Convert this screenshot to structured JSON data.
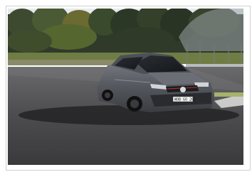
{
  "image": {
    "subject": "car-photo",
    "license_plate": "WOB GO 202",
    "colors": {
      "car_body": "#5a5c62",
      "track_asphalt": "#4a4a4c",
      "sky": "#d6dde3",
      "forest": "#2f3a2a",
      "grass": "#6f8a3a"
    }
  }
}
